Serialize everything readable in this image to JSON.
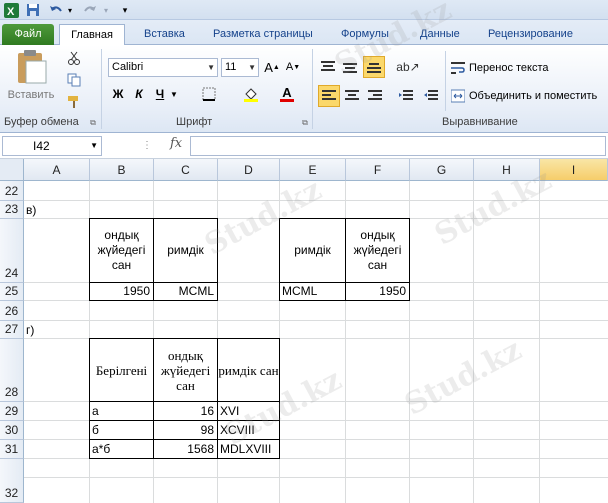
{
  "ribbon": {
    "tabs": [
      "Файл",
      "Главная",
      "Вставка",
      "Разметка страницы",
      "Формулы",
      "Данные",
      "Рецензирование"
    ],
    "clipboard": {
      "paste_label": "Вставить",
      "group_label": "Буфер обмена"
    },
    "font": {
      "name": "Calibri",
      "size": "11",
      "group_label": "Шрифт",
      "bold": "Ж",
      "italic": "К",
      "underline": "Ч"
    },
    "alignment": {
      "wrap_text": "Перенос текста",
      "merge_center": "Объединить и поместить",
      "group_label": "Выравнивание"
    }
  },
  "formula_bar": {
    "name_box": "I42",
    "fx_label": "fx",
    "value": ""
  },
  "columns": [
    "A",
    "B",
    "C",
    "D",
    "E",
    "F",
    "G",
    "H",
    "I"
  ],
  "rows": [
    "22",
    "23",
    "24",
    "25",
    "26",
    "27",
    "28",
    "29",
    "30",
    "31",
    "32"
  ],
  "sheet": {
    "section_v": "в)",
    "section_g": "г)",
    "table1": {
      "h1": "ондық жүйедегі сан",
      "h2": "римдік",
      "v1": "1950",
      "v2": "MCML"
    },
    "table2": {
      "h1": "римдік",
      "h2": "ондық жүйедегі сан",
      "v1": "MCML",
      "v2": "1950"
    },
    "table3": {
      "h1": "Берілгені",
      "h2": "ондық жүйедегі сан",
      "h3": "римдік сан",
      "rows": [
        [
          "а",
          "16",
          "XVI"
        ],
        [
          "б",
          "98",
          "XCVIII"
        ],
        [
          "а*б",
          "1568",
          "MDLXVIII"
        ]
      ]
    }
  },
  "watermark": "Stud.kz"
}
